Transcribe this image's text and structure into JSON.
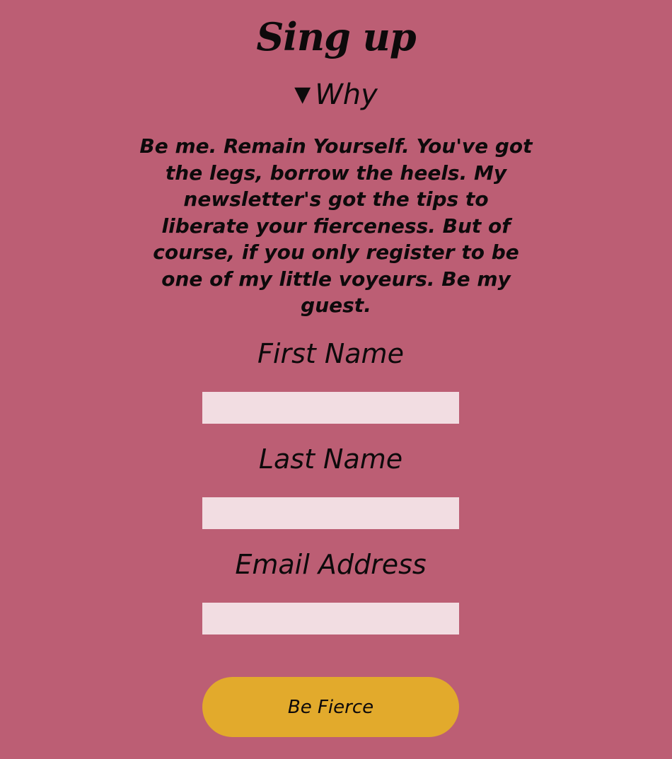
{
  "page": {
    "title": "Sing up"
  },
  "why": {
    "triangle": "▼",
    "label": "Why",
    "text": "Be me. Remain Yourself. You've got the legs, borrow the heels. My newsletter's got the tips to liberate your fierceness. But of course, if you only register to be one of my little voyeurs. Be my guest."
  },
  "form": {
    "first_name_label": "First Name",
    "first_name_value": "",
    "last_name_label": "Last Name",
    "last_name_value": "",
    "email_label": "Email Address",
    "email_value": "",
    "submit_label": "Be Fierce"
  },
  "colors": {
    "background": "#bc5e74",
    "input_fill": "#f2dde2",
    "button": "#e2aa2c",
    "text": "#0d0a0b"
  }
}
